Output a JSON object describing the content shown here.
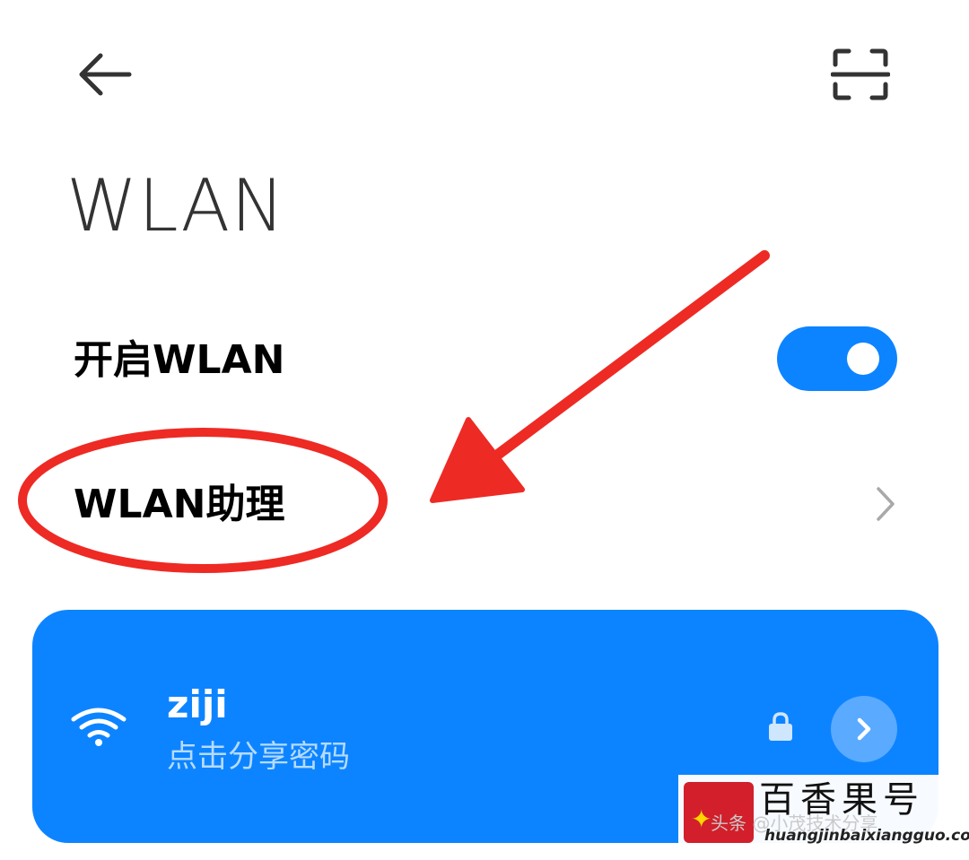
{
  "header": {
    "back_icon": "arrow-left-icon",
    "scan_icon": "scan-qr-icon"
  },
  "page": {
    "title": "WLAN"
  },
  "settings": {
    "wlan_toggle_label": "开启WLAN",
    "wlan_enabled": true,
    "wlan_assistant_label": "WLAN助理"
  },
  "connected_network": {
    "ssid": "ziji",
    "hint": "点击分享密码",
    "secured": true,
    "signal_icon": "wifi-icon"
  },
  "watermark": {
    "brand": "百香果号",
    "byline": "头条 @小茂技术分享",
    "url": "huangjinbaixiangguo.com"
  },
  "colors": {
    "accent": "#0d84ff",
    "annotation": "#ee2a24",
    "text_primary": "#000000",
    "title": "#333333"
  }
}
